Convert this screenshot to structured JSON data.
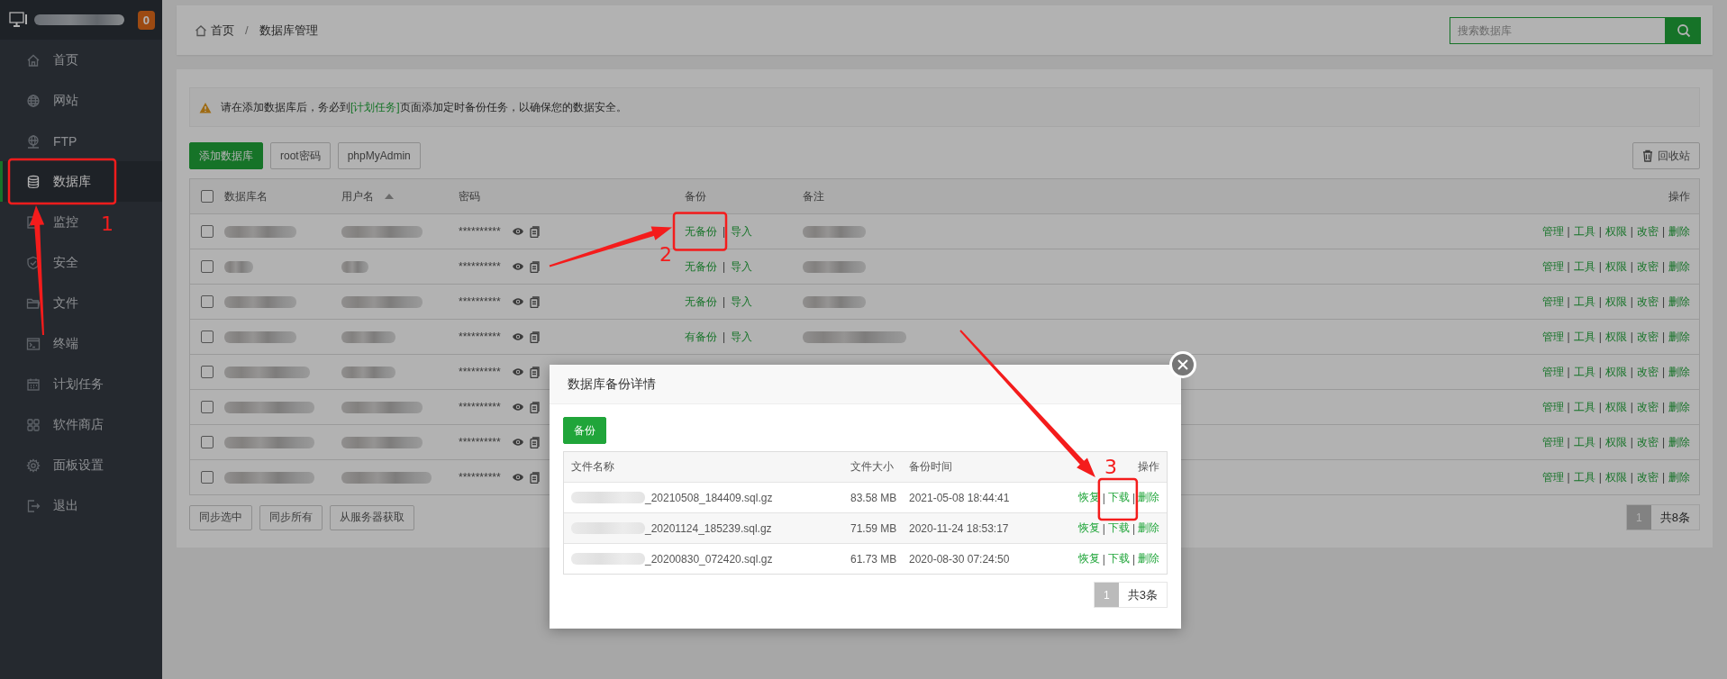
{
  "sidebar": {
    "badge": "0",
    "items": [
      {
        "label": "首页",
        "selected": false
      },
      {
        "label": "网站",
        "selected": false
      },
      {
        "label": "FTP",
        "selected": false
      },
      {
        "label": "数据库",
        "selected": true
      },
      {
        "label": "监控",
        "selected": false
      },
      {
        "label": "安全",
        "selected": false
      },
      {
        "label": "文件",
        "selected": false
      },
      {
        "label": "终端",
        "selected": false
      },
      {
        "label": "计划任务",
        "selected": false
      },
      {
        "label": "软件商店",
        "selected": false
      },
      {
        "label": "面板设置",
        "selected": false
      },
      {
        "label": "退出",
        "selected": false
      }
    ]
  },
  "breadcrumb": [
    "首页",
    "数据库管理"
  ],
  "breadcrumb_separator": "/",
  "link_separator": "|",
  "search": {
    "placeholder": "搜索数据库"
  },
  "alert": {
    "before": "请在添加数据库后，务必到",
    "link": "[计划任务]",
    "after": "页面添加定时备份任务，以确保您的数据安全。"
  },
  "toolbar": {
    "buttons": [
      "添加数据库",
      "root密码",
      "phpMyAdmin"
    ],
    "recycle": "回收站"
  },
  "table": {
    "select_all_checked": false,
    "columns": [
      "数据库名",
      "用户名",
      "密码",
      "备份",
      "备注",
      "操作"
    ],
    "rows": [
      {
        "checked": false,
        "password": "**********",
        "backup": "无备份",
        "import": "导入",
        "actions": [
          "管理",
          "工具",
          "权限",
          "改密",
          "删除"
        ]
      },
      {
        "checked": false,
        "password": "**********",
        "backup": "无备份",
        "import": "导入",
        "actions": [
          "管理",
          "工具",
          "权限",
          "改密",
          "删除"
        ]
      },
      {
        "checked": false,
        "password": "**********",
        "backup": "无备份",
        "import": "导入",
        "actions": [
          "管理",
          "工具",
          "权限",
          "改密",
          "删除"
        ]
      },
      {
        "checked": false,
        "password": "**********",
        "backup": "有备份",
        "import": "导入",
        "actions": [
          "管理",
          "工具",
          "权限",
          "改密",
          "删除"
        ]
      },
      {
        "checked": false,
        "password": "**********",
        "actions": [
          "管理",
          "工具",
          "权限",
          "改密",
          "删除"
        ]
      },
      {
        "checked": false,
        "password": "**********",
        "actions": [
          "管理",
          "工具",
          "权限",
          "改密",
          "删除"
        ]
      },
      {
        "checked": false,
        "password": "**********",
        "actions": [
          "管理",
          "工具",
          "权限",
          "改密",
          "删除"
        ]
      },
      {
        "checked": false,
        "password": "**********",
        "actions": [
          "管理",
          "工具",
          "权限",
          "改密",
          "删除"
        ]
      }
    ]
  },
  "bottom_buttons": [
    "同步选中",
    "同步所有",
    "从服务器获取"
  ],
  "pagination": {
    "page": "1",
    "total": "共8条"
  },
  "modal": {
    "title": "数据库备份详情",
    "backup_button": "备份",
    "columns": [
      "文件名称",
      "文件大小",
      "备份时间",
      "操作"
    ],
    "rows": [
      {
        "file": "_20210508_184409.sql.gz",
        "size": "83.58 MB",
        "time": "2021-05-08 18:44:41",
        "actions": [
          "恢复",
          "下载",
          "删除"
        ]
      },
      {
        "file": "_20201124_185239.sql.gz",
        "size": "71.59 MB",
        "time": "2020-11-24 18:53:17",
        "actions": [
          "恢复",
          "下载",
          "删除"
        ]
      },
      {
        "file": "_20200830_072420.sql.gz",
        "size": "61.73 MB",
        "time": "2020-08-30 07:24:50",
        "actions": [
          "恢复",
          "下载",
          "删除"
        ]
      }
    ],
    "pagination": {
      "page": "1",
      "total": "共3条"
    }
  },
  "annotations": [
    {
      "number": "1"
    },
    {
      "number": "2"
    },
    {
      "number": "3"
    }
  ]
}
